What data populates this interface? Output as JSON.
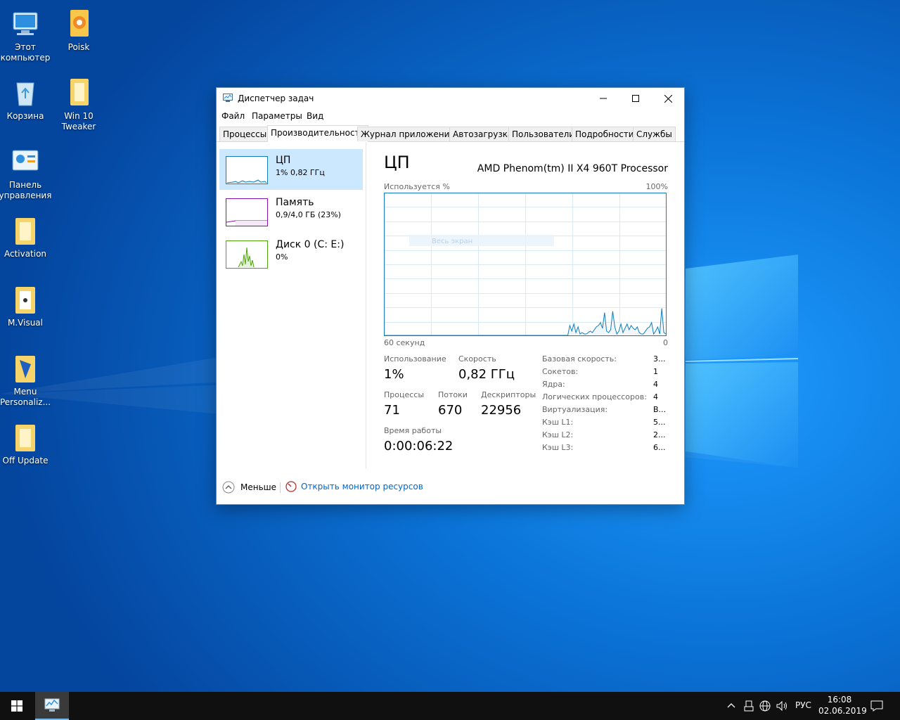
{
  "desktop": {
    "icons": [
      {
        "label": "Этот компьютер"
      },
      {
        "label": "Poisk"
      },
      {
        "label": "Корзина"
      },
      {
        "label": "Win 10 Tweaker"
      },
      {
        "label": "Панель управления"
      },
      {
        "label": "Activation"
      },
      {
        "label": "M.Visual"
      },
      {
        "label": "Menu Personaliz..."
      },
      {
        "label": "Off Update"
      }
    ]
  },
  "window": {
    "title": "Диспетчер задач",
    "menu": [
      "Файл",
      "Параметры",
      "Вид"
    ],
    "tabs": [
      "Процессы",
      "Производительность",
      "Журнал приложений",
      "Автозагрузка",
      "Пользователи",
      "Подробности",
      "Службы"
    ],
    "active_tab": "Производительность",
    "left_items": [
      {
        "name": "ЦП",
        "detail": "1%  0,82 ГГц",
        "color": "#117dbb"
      },
      {
        "name": "Память",
        "detail": "0,9/4,0 ГБ (23%)",
        "color": "#8b12ae"
      },
      {
        "name": "Диск 0 (C: E:)",
        "detail": "0%",
        "color": "#4da60c"
      }
    ],
    "cpu": {
      "title": "ЦП",
      "processor": "AMD Phenom(tm) II X4 960T Processor",
      "graph_top_left": "Используется %",
      "graph_top_right": "100%",
      "graph_bottom_left": "60 секунд",
      "graph_bottom_right": "0",
      "overlay_text": "Весь экран",
      "stats": {
        "usage_label": "Использование",
        "usage_value": "1%",
        "speed_label": "Скорость",
        "speed_value": "0,82 ГГц",
        "processes_label": "Процессы",
        "processes_value": "71",
        "threads_label": "Потоки",
        "threads_value": "670",
        "handles_label": "Дескрипторы",
        "handles_value": "22956",
        "uptime_label": "Время работы",
        "uptime_value": "0:00:06:22"
      },
      "properties": [
        {
          "name": "Базовая скорость:",
          "value": "3..."
        },
        {
          "name": "Сокетов:",
          "value": "1"
        },
        {
          "name": "Ядра:",
          "value": "4"
        },
        {
          "name": "Логических процессоров:",
          "value": "4"
        },
        {
          "name": "Виртуализация:",
          "value": "В..."
        },
        {
          "name": "Кэш L1:",
          "value": "5..."
        },
        {
          "name": "Кэш L2:",
          "value": "2..."
        },
        {
          "name": "Кэш L3:",
          "value": "6..."
        }
      ],
      "usage_history": [
        0,
        0,
        0,
        0,
        0,
        0,
        0,
        0,
        0,
        0,
        0,
        0,
        0,
        0,
        0,
        0,
        0,
        0,
        0,
        0,
        0,
        0,
        0,
        0,
        0,
        0,
        0,
        0,
        0,
        0,
        0,
        0,
        0,
        0,
        0,
        0,
        0,
        0,
        0,
        0,
        0,
        0,
        0,
        0,
        0,
        0,
        0,
        0,
        0,
        0,
        0,
        0,
        0,
        0,
        0,
        0,
        0,
        0,
        0,
        0,
        0,
        0,
        0,
        0,
        0,
        0,
        0,
        0,
        0,
        0,
        0,
        0,
        0,
        0,
        0,
        0,
        0,
        0,
        0,
        0,
        0,
        0,
        0,
        0,
        0,
        0,
        0,
        0,
        0,
        0,
        0,
        7,
        3,
        8,
        2,
        6,
        1,
        2,
        1,
        1,
        2,
        3,
        2,
        4,
        6,
        7,
        9,
        5,
        16,
        3,
        2,
        4,
        17,
        6,
        1,
        3,
        8,
        2,
        5,
        8,
        4,
        7,
        5,
        4,
        6,
        2,
        1,
        1,
        3,
        5,
        6,
        9,
        1,
        3,
        6,
        1,
        19,
        2,
        1
      ]
    },
    "footer": {
      "less_label": "Меньше",
      "monitor_link": "Открыть монитор ресурсов"
    }
  },
  "taskbar": {
    "language": "РУС",
    "time": "16:08",
    "date": "02.06.2019"
  },
  "colors": {
    "cpu_line": "#117dbb",
    "cpu_fill": "#f1f6fa",
    "grid": "#d9eaf4",
    "link": "#0066cc"
  }
}
